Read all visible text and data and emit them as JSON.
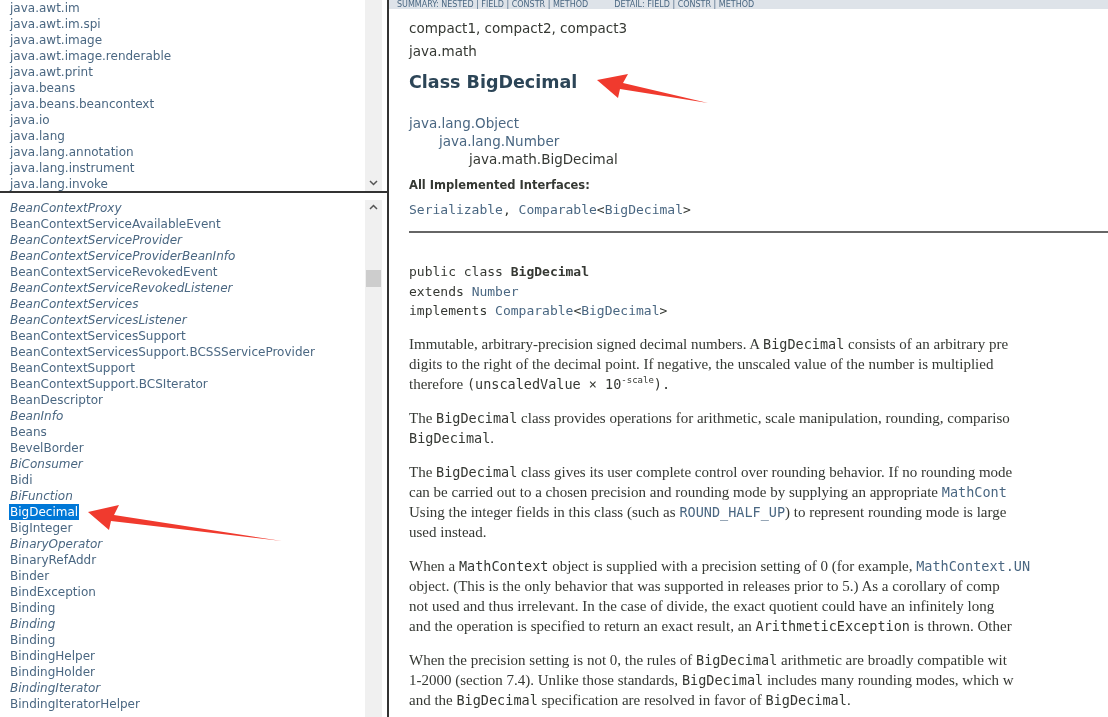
{
  "package_list": {
    "items": [
      {
        "label": "java.awt.im"
      },
      {
        "label": "java.awt.im.spi"
      },
      {
        "label": "java.awt.image"
      },
      {
        "label": "java.awt.image.renderable"
      },
      {
        "label": "java.awt.print"
      },
      {
        "label": "java.beans"
      },
      {
        "label": "java.beans.beancontext"
      },
      {
        "label": "java.io"
      },
      {
        "label": "java.lang"
      },
      {
        "label": "java.lang.annotation"
      },
      {
        "label": "java.lang.instrument"
      },
      {
        "label": "java.lang.invoke"
      }
    ]
  },
  "class_list": {
    "items": [
      {
        "label": "BeanContextProxy",
        "italic": true,
        "selected": false
      },
      {
        "label": "BeanContextServiceAvailableEvent",
        "italic": false,
        "selected": false
      },
      {
        "label": "BeanContextServiceProvider",
        "italic": true,
        "selected": false
      },
      {
        "label": "BeanContextServiceProviderBeanInfo",
        "italic": true,
        "selected": false
      },
      {
        "label": "BeanContextServiceRevokedEvent",
        "italic": false,
        "selected": false
      },
      {
        "label": "BeanContextServiceRevokedListener",
        "italic": true,
        "selected": false
      },
      {
        "label": "BeanContextServices",
        "italic": true,
        "selected": false
      },
      {
        "label": "BeanContextServicesListener",
        "italic": true,
        "selected": false
      },
      {
        "label": "BeanContextServicesSupport",
        "italic": false,
        "selected": false
      },
      {
        "label": "BeanContextServicesSupport.BCSSServiceProvider",
        "italic": false,
        "selected": false
      },
      {
        "label": "BeanContextSupport",
        "italic": false,
        "selected": false
      },
      {
        "label": "BeanContextSupport.BCSIterator",
        "italic": false,
        "selected": false
      },
      {
        "label": "BeanDescriptor",
        "italic": false,
        "selected": false
      },
      {
        "label": "BeanInfo",
        "italic": true,
        "selected": false
      },
      {
        "label": "Beans",
        "italic": false,
        "selected": false
      },
      {
        "label": "BevelBorder",
        "italic": false,
        "selected": false
      },
      {
        "label": "BiConsumer",
        "italic": true,
        "selected": false
      },
      {
        "label": "Bidi",
        "italic": false,
        "selected": false
      },
      {
        "label": "BiFunction",
        "italic": true,
        "selected": false
      },
      {
        "label": "BigDecimal",
        "italic": false,
        "selected": true
      },
      {
        "label": "BigInteger",
        "italic": false,
        "selected": false
      },
      {
        "label": "BinaryOperator",
        "italic": true,
        "selected": false
      },
      {
        "label": "BinaryRefAddr",
        "italic": false,
        "selected": false
      },
      {
        "label": "Binder",
        "italic": false,
        "selected": false
      },
      {
        "label": "BindException",
        "italic": false,
        "selected": false
      },
      {
        "label": "Binding",
        "italic": false,
        "selected": false
      },
      {
        "label": "Binding",
        "italic": true,
        "selected": false
      },
      {
        "label": "Binding",
        "italic": false,
        "selected": false
      },
      {
        "label": "BindingHelper",
        "italic": false,
        "selected": false
      },
      {
        "label": "BindingHolder",
        "italic": false,
        "selected": false
      },
      {
        "label": "BindingIterator",
        "italic": true,
        "selected": false
      },
      {
        "label": "BindingIteratorHelper",
        "italic": false,
        "selected": false
      }
    ]
  },
  "nav_bar": {
    "summary": "SUMMARY: NESTED | FIELD | CONSTR | METHOD",
    "detail": "DETAIL: FIELD | CONSTR | METHOD"
  },
  "header": {
    "profiles": "compact1, compact2, compact3",
    "package": "java.math",
    "title": "Class BigDecimal"
  },
  "inheritance": [
    {
      "label": "java.lang.Object",
      "link": true,
      "children": [
        {
          "label": "java.lang.Number",
          "link": true,
          "children": [
            {
              "label": "java.math.BigDecimal",
              "link": false
            }
          ]
        }
      ]
    }
  ],
  "interfaces": {
    "heading": "All Implemented Interfaces:",
    "segments": [
      {
        "text": "Serializable",
        "kind": "link"
      },
      {
        "text": ", ",
        "kind": "code"
      },
      {
        "text": "Comparable",
        "kind": "link"
      },
      {
        "text": "<",
        "kind": "code"
      },
      {
        "text": "BigDecimal",
        "kind": "link"
      },
      {
        "text": ">",
        "kind": "code"
      }
    ]
  },
  "signature": [
    [
      {
        "text": "public class ",
        "kind": "code"
      },
      {
        "text": "BigDecimal",
        "kind": "strong"
      }
    ],
    [
      {
        "text": "extends ",
        "kind": "code"
      },
      {
        "text": "Number",
        "kind": "link"
      }
    ],
    [
      {
        "text": "implements ",
        "kind": "code"
      },
      {
        "text": "Comparable",
        "kind": "link"
      },
      {
        "text": "<",
        "kind": "code"
      },
      {
        "text": "BigDecimal",
        "kind": "link"
      },
      {
        "text": ">",
        "kind": "code"
      }
    ]
  ],
  "paragraphs": [
    {
      "lines": [
        [
          {
            "text": "Immutable, arbitrary-precision signed decimal numbers. A ",
            "kind": "text"
          },
          {
            "text": "BigDecimal",
            "kind": "code"
          },
          {
            "text": " consists of an arbitrary pre",
            "kind": "text"
          }
        ],
        [
          {
            "text": "digits to the right of the decimal point. If negative, the unscaled value of the number is multiplied",
            "kind": "text"
          }
        ],
        [
          {
            "text": "therefore ",
            "kind": "text"
          },
          {
            "text": "(unscaledValue × 10",
            "kind": "code"
          },
          {
            "text": "-scale",
            "kind": "sup"
          },
          {
            "text": ").",
            "kind": "code"
          }
        ]
      ]
    },
    {
      "lines": [
        [
          {
            "text": "The ",
            "kind": "text"
          },
          {
            "text": "BigDecimal",
            "kind": "code"
          },
          {
            "text": " class provides operations for arithmetic, scale manipulation, rounding, compariso",
            "kind": "text"
          }
        ],
        [
          {
            "text": "BigDecimal",
            "kind": "code"
          },
          {
            "text": ".",
            "kind": "text"
          }
        ]
      ]
    },
    {
      "lines": [
        [
          {
            "text": "The ",
            "kind": "text"
          },
          {
            "text": "BigDecimal",
            "kind": "code"
          },
          {
            "text": " class gives its user complete control over rounding behavior. If no rounding mode",
            "kind": "text"
          }
        ],
        [
          {
            "text": "can be carried out to a chosen precision and rounding mode by supplying an appropriate ",
            "kind": "text"
          },
          {
            "text": "MathCont",
            "kind": "link"
          }
        ],
        [
          {
            "text": "Using the integer fields in this class (such as ",
            "kind": "text"
          },
          {
            "text": "ROUND_HALF_UP",
            "kind": "link"
          },
          {
            "text": ") to represent rounding mode is large",
            "kind": "text"
          }
        ],
        [
          {
            "text": "used instead.",
            "kind": "text"
          }
        ]
      ]
    },
    {
      "lines": [
        [
          {
            "text": "When a ",
            "kind": "text"
          },
          {
            "text": "MathContext",
            "kind": "code"
          },
          {
            "text": " object is supplied with a precision setting of 0 (for example, ",
            "kind": "text"
          },
          {
            "text": "MathContext.UN",
            "kind": "link"
          }
        ],
        [
          {
            "text": "object. (This is the only behavior that was supported in releases prior to 5.) As a corollary of comp",
            "kind": "text"
          }
        ],
        [
          {
            "text": "not used and thus irrelevant. In the case of divide, the exact quotient could have an infinitely long",
            "kind": "text"
          }
        ],
        [
          {
            "text": "and the operation is specified to return an exact result, an ",
            "kind": "text"
          },
          {
            "text": "ArithmeticException",
            "kind": "code"
          },
          {
            "text": " is thrown. Other",
            "kind": "text"
          }
        ]
      ]
    },
    {
      "lines": [
        [
          {
            "text": "When the precision setting is not 0, the rules of ",
            "kind": "text"
          },
          {
            "text": "BigDecimal",
            "kind": "code"
          },
          {
            "text": " arithmetic are broadly compatible wit",
            "kind": "text"
          }
        ],
        [
          {
            "text": "1-2000 (section 7.4). Unlike those standards, ",
            "kind": "text"
          },
          {
            "text": "BigDecimal",
            "kind": "code"
          },
          {
            "text": " includes many rounding modes, which w",
            "kind": "text"
          }
        ],
        [
          {
            "text": "and the ",
            "kind": "text"
          },
          {
            "text": "BigDecimal",
            "kind": "code"
          },
          {
            "text": " specification are resolved in favor of ",
            "kind": "text"
          },
          {
            "text": "BigDecimal",
            "kind": "code"
          },
          {
            "text": ".",
            "kind": "text"
          }
        ]
      ]
    }
  ],
  "annotations": [
    {
      "kind": "arrow"
    },
    {
      "kind": "arrow"
    }
  ]
}
